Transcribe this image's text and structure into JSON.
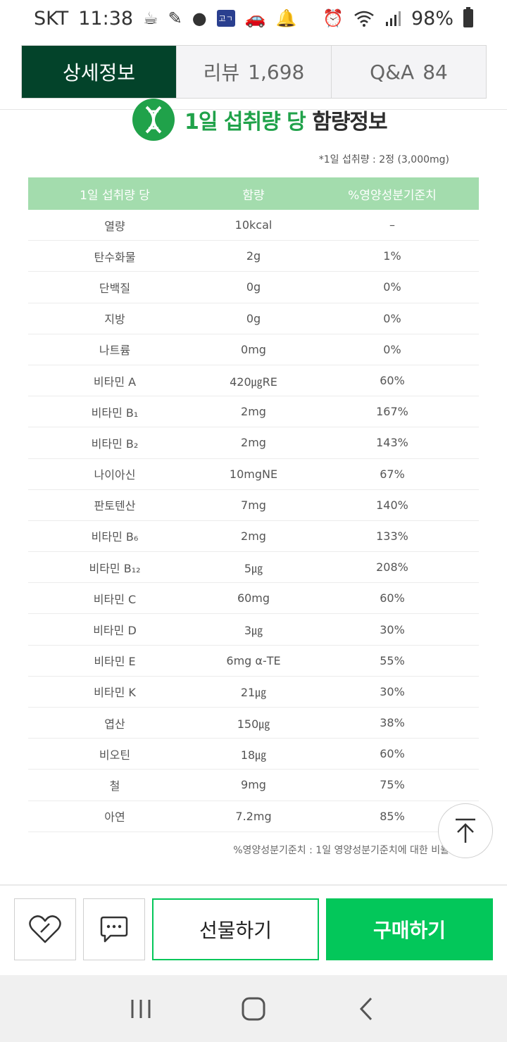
{
  "status_bar": {
    "carrier": "SKT",
    "time": "11:38",
    "battery": "98%",
    "app_badge": "고ㄱ"
  },
  "tabs": [
    {
      "label": "상세정보",
      "count": ""
    },
    {
      "label": "리뷰",
      "count": "1,698"
    },
    {
      "label": "Q&A",
      "count": "84"
    }
  ],
  "heading": {
    "highlight": "1일 섭취량 당",
    "rest": "함량정보"
  },
  "dose_note": "*1일 섭취량 : 2정 (3,000mg)",
  "table": {
    "headers": [
      "1일 섭취량 당",
      "함량",
      "%영양성분기준치"
    ],
    "rows": [
      [
        "열량",
        "10kcal",
        "–"
      ],
      [
        "탄수화물",
        "2g",
        "1%"
      ],
      [
        "단백질",
        "0g",
        "0%"
      ],
      [
        "지방",
        "0g",
        "0%"
      ],
      [
        "나트륨",
        "0mg",
        "0%"
      ],
      [
        "비타민 A",
        "420㎍RE",
        "60%"
      ],
      [
        "비타민 B₁",
        "2mg",
        "167%"
      ],
      [
        "비타민 B₂",
        "2mg",
        "143%"
      ],
      [
        "나이아신",
        "10mgNE",
        "67%"
      ],
      [
        "판토텐산",
        "7mg",
        "140%"
      ],
      [
        "비타민 B₆",
        "2mg",
        "133%"
      ],
      [
        "비타민 B₁₂",
        "5㎍",
        "208%"
      ],
      [
        "비타민 C",
        "60mg",
        "60%"
      ],
      [
        "비타민 D",
        "3㎍",
        "30%"
      ],
      [
        "비타민 E",
        "6mg α-TE",
        "55%"
      ],
      [
        "비타민 K",
        "21㎍",
        "30%"
      ],
      [
        "엽산",
        "150㎍",
        "38%"
      ],
      [
        "비오틴",
        "18㎍",
        "60%"
      ],
      [
        "철",
        "9mg",
        "75%"
      ],
      [
        "아연",
        "7.2mg",
        "85%"
      ]
    ]
  },
  "footnote": "%영양성분기준치 : 1일 영양성분기준치에 대한 비율",
  "actions": {
    "gift_label": "선물하기",
    "buy_label": "구매하기"
  },
  "colors": {
    "tab_active": "#03432a",
    "brand_green": "#03c75a",
    "table_header": "#a3dcad",
    "heading_green": "#20a24a"
  }
}
